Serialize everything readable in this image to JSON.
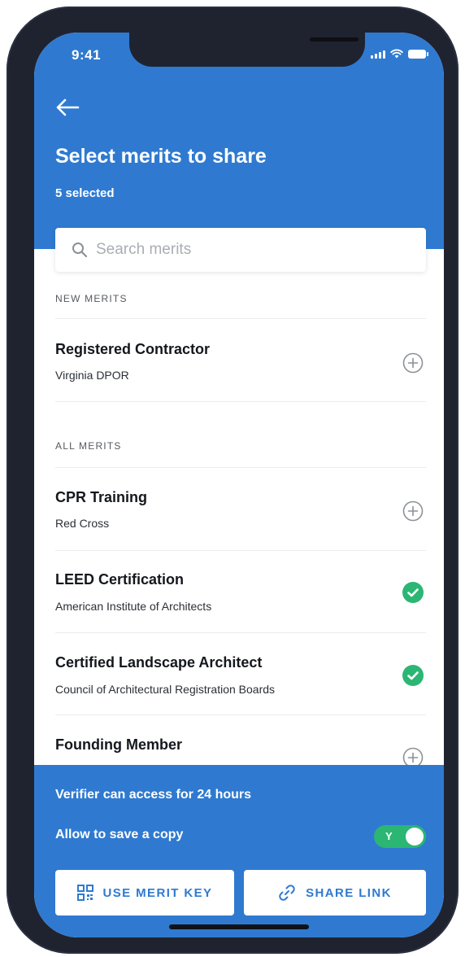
{
  "status_bar": {
    "time": "9:41"
  },
  "header": {
    "title": "Select merits to share",
    "subtitle": "5 selected"
  },
  "search": {
    "placeholder": "Search merits"
  },
  "sections": {
    "new": {
      "label": "NEW MERITS",
      "items": [
        {
          "title": "Registered Contractor",
          "issuer": "Virginia DPOR",
          "selected": false
        }
      ]
    },
    "all": {
      "label": "ALL MERITS",
      "items": [
        {
          "title": "CPR Training",
          "issuer": "Red Cross",
          "selected": false
        },
        {
          "title": "LEED Certification",
          "issuer": "American Institute of Architects",
          "selected": true
        },
        {
          "title": "Certified Landscape Architect",
          "issuer": "Council of Architectural Registration Boards",
          "selected": true
        },
        {
          "title": "Founding Member",
          "issuer": "",
          "selected": false
        }
      ]
    }
  },
  "footer": {
    "access_text": "Verifier can access for 24 hours",
    "save_copy_text": "Allow to save a copy",
    "save_copy_toggle": {
      "label": "Y",
      "on": true
    },
    "merit_key_button": "USE MERIT KEY",
    "share_link_button": "SHARE LINK"
  },
  "colors": {
    "brand_blue": "#2f7ad0",
    "selected_green": "#2bb673",
    "frame": "#1f2330"
  },
  "icons": {
    "back": "arrow-left-icon",
    "search": "search-icon",
    "add": "plus-circle-icon",
    "selected": "check-circle-icon",
    "merit_key": "qr-code-icon",
    "share_link": "link-icon"
  }
}
